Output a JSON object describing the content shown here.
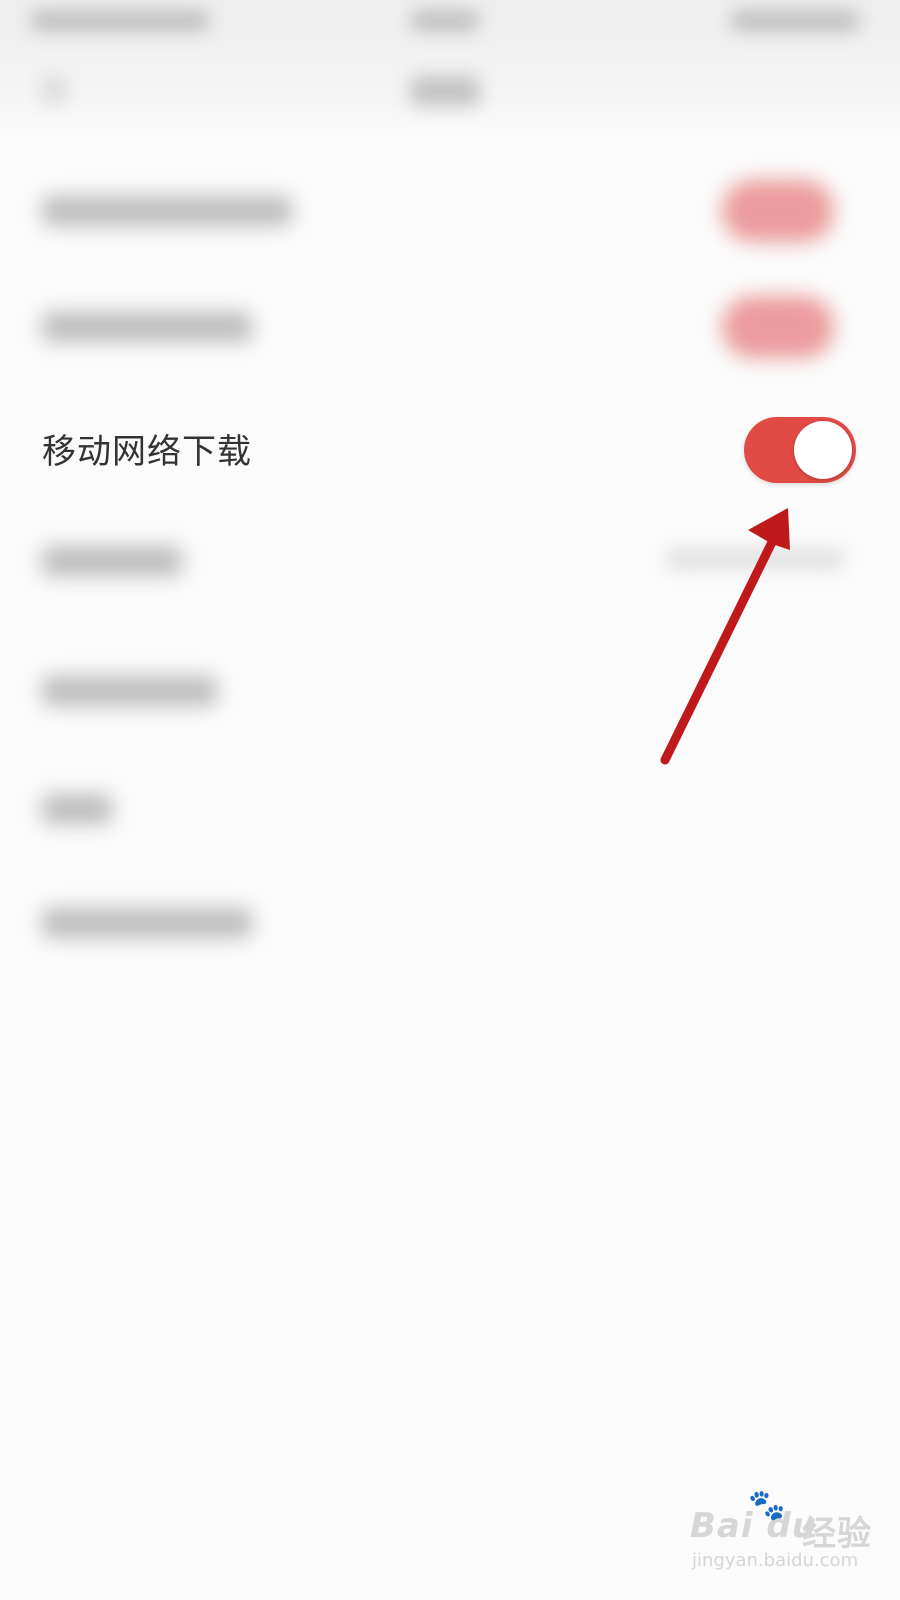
{
  "settings": {
    "mobile_download": {
      "label": "移动网络下载",
      "enabled": true
    }
  },
  "colors": {
    "toggle_on": "#e14a45",
    "annotation_arrow": "#c0191b",
    "background": "#fbfbfb"
  },
  "watermark": {
    "brand": "Bai du",
    "brand_cn": "经验",
    "site": "jingyan.baidu.com"
  }
}
